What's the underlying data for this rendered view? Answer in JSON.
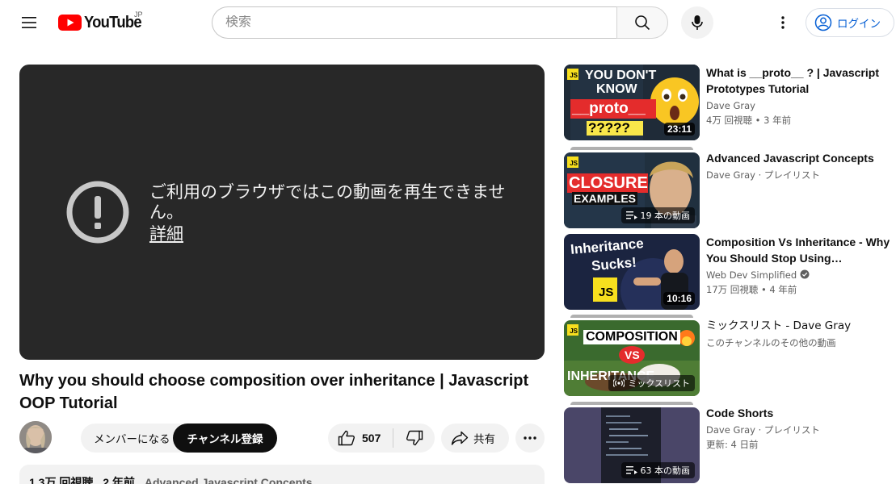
{
  "header": {
    "logo_text": "YouTube",
    "region": "JP",
    "search_placeholder": "検索",
    "login_label": "ログイン"
  },
  "player": {
    "error_message": "ご利用のブラウザではこの動画を再生できません。",
    "error_link": "詳細"
  },
  "video": {
    "title": "Why you should choose composition over inheritance | Javascript OOP Tutorial",
    "member_label": "メンバーになる",
    "subscribe_label": "チャンネル登録",
    "likes": "507",
    "share_label": "共有",
    "description": {
      "views": "1.3万 回視聴",
      "age": "2 年前",
      "tag": "Advanced Javascript Concepts"
    }
  },
  "recommendations": [
    {
      "title": "What is __proto__ ? | Javascript Prototypes Tutorial",
      "channel": "Dave Gray",
      "views": "4万 回視聴",
      "age": "3 年前",
      "duration": "23:11",
      "thumb_text": [
        "YOU DON'T",
        "KNOW",
        "__proto__",
        "?????"
      ]
    },
    {
      "title": "Advanced Javascript Concepts",
      "channel": "Dave Gray · プレイリスト",
      "badge": "19 本の動画",
      "thumb_text": [
        "CLOSURE",
        "EXAMPLES"
      ]
    },
    {
      "title": "Composition Vs Inheritance - Why You Should Stop Using…",
      "channel": "Web Dev Simplified",
      "views": "17万 回視聴",
      "age": "4 年前",
      "duration": "10:16",
      "thumb_text": [
        "Inheritance",
        "Sucks!",
        "JS"
      ]
    },
    {
      "title": "ミックスリスト - Dave Gray",
      "channel": "このチャンネルのその他の動画",
      "badge": "ミックスリスト",
      "thumb_text": [
        "COMPOSITION",
        "VS",
        "INHERITANCE"
      ]
    },
    {
      "title": "Code Shorts",
      "channel": "Dave Gray · プレイリスト",
      "updated": "更新: 4 日前",
      "badge": "63 本の動画"
    }
  ],
  "colors": {
    "brand_red": "#ff0000",
    "player_bg": "#282828",
    "link_blue": "#065fd4",
    "chip_bg": "#f2f2f2"
  },
  "icons": [
    "menu-icon",
    "youtube-logo-icon",
    "search-icon",
    "mic-icon",
    "more-vert-icon",
    "account-icon",
    "error-icon",
    "thumbs-up-icon",
    "thumbs-down-icon",
    "share-icon",
    "more-horiz-icon",
    "playlist-icon",
    "mix-icon",
    "verified-icon"
  ]
}
